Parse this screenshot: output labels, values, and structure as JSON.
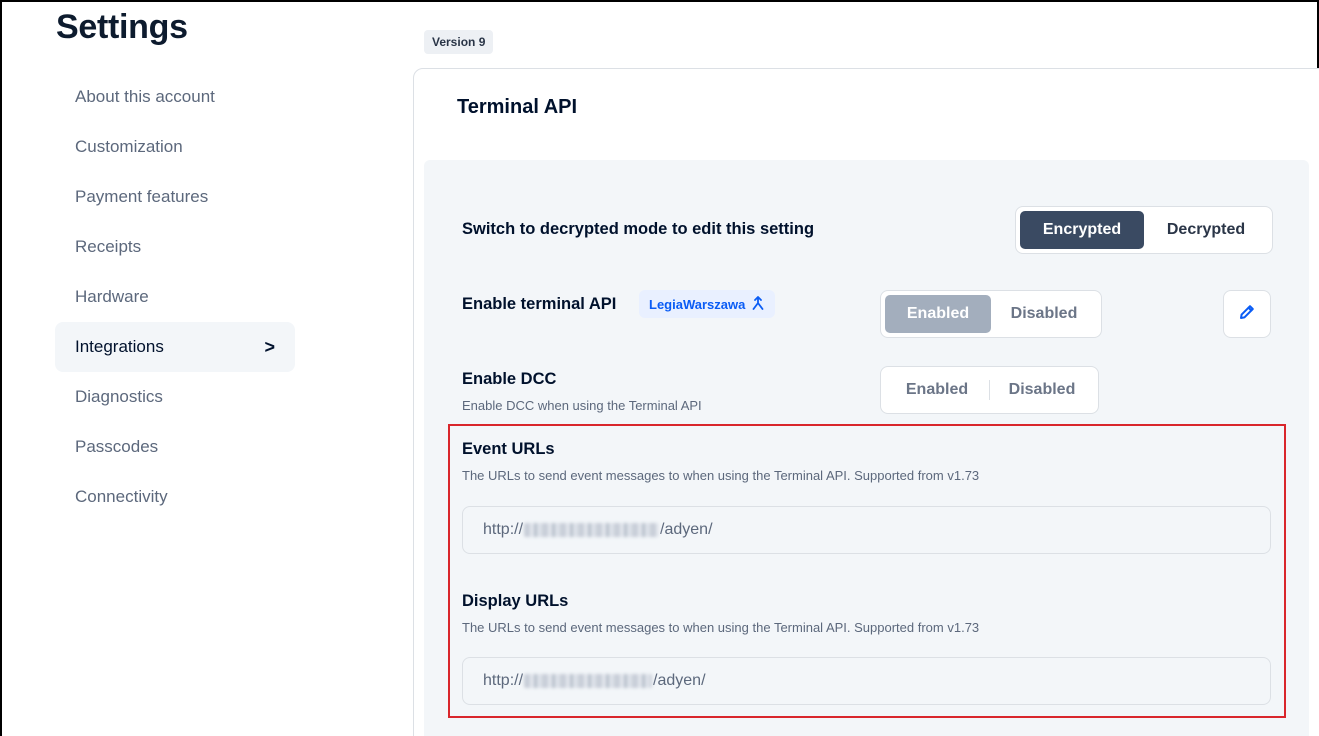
{
  "page": {
    "title": "Settings"
  },
  "sidebar": {
    "items": [
      {
        "label": "About this account"
      },
      {
        "label": "Customization"
      },
      {
        "label": "Payment features"
      },
      {
        "label": "Receipts"
      },
      {
        "label": "Hardware"
      },
      {
        "label": "Integrations",
        "active": true,
        "chevron": ">"
      },
      {
        "label": "Diagnostics"
      },
      {
        "label": "Passcodes"
      },
      {
        "label": "Connectivity"
      }
    ]
  },
  "version_badge": "Version 9",
  "card": {
    "title": "Terminal API",
    "mode_row": {
      "label": "Switch to decrypted mode to edit this setting",
      "options": [
        "Encrypted",
        "Decrypted"
      ],
      "selected": "Encrypted"
    },
    "terminal_api_row": {
      "label": "Enable terminal API",
      "inherited_from": "LegiaWarszawa",
      "inherited_icon": "inherit-arrow-icon",
      "options": [
        "Enabled",
        "Disabled"
      ],
      "selected": "Enabled",
      "edit_icon": "pencil-icon"
    },
    "dcc_row": {
      "label": "Enable DCC",
      "description": "Enable DCC when using the Terminal API",
      "options": [
        "Enabled",
        "Disabled"
      ],
      "selected": null
    },
    "event_urls": {
      "label": "Event URLs",
      "description": "The URLs to send event messages to when using the Terminal API. Supported from v1.73",
      "value_prefix": "http://",
      "value_suffix": "/adyen/"
    },
    "display_urls": {
      "label": "Display URLs",
      "description": "The URLs to send event messages to when using the Terminal API. Supported from v1.73",
      "value_prefix": "http://",
      "value_suffix": "/adyen/"
    }
  },
  "colors": {
    "accent_dark": "#3a4a62",
    "accent_grey": "#a3aebd",
    "link_blue": "#0a5cf5",
    "highlight_red": "#d9262c",
    "panel_bg": "#f3f6f9"
  }
}
